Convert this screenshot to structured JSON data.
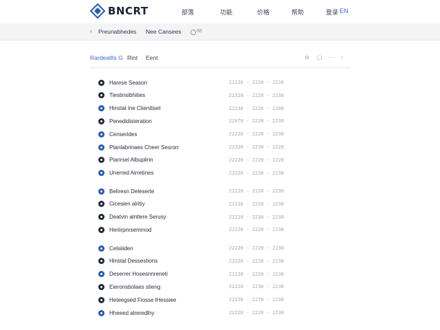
{
  "header": {
    "logo_text": "BNCRT",
    "nav": [
      "部落",
      "功能",
      "价格",
      "帮助",
      "登录",
      "EN"
    ]
  },
  "subbar": {
    "left_label": "Preunabhedes",
    "right_label": "Nee Cansees",
    "small_label": "88"
  },
  "toolbar": {
    "tabs": [
      "Rardeatlts G",
      "Rint",
      "Eent"
    ]
  },
  "groups": [
    {
      "rows": [
        {
          "label": "Harese Season",
          "date": "22228 - 2220 - 2228",
          "color": "#1f2937"
        },
        {
          "label": "Tiestinsibhities",
          "date": "22328 - 2228 - 2238",
          "color": "#1f2937"
        },
        {
          "label": "Hinstat lne Clienitiset",
          "date": "22238 - 2226 - 2288",
          "color": "#2a5aa6"
        },
        {
          "label": "Penedidisteration",
          "date": "22078 - 2228 - 2238",
          "color": "#1f2937"
        },
        {
          "label": "Censerides",
          "date": "22228 - 2228 - 2238",
          "color": "#2a5aa6"
        },
        {
          "label": "Ptanlabrinaes Cheer Sesrorr",
          "date": "22328 - 2230 - 2228",
          "color": "#2a5aa6"
        },
        {
          "label": "Pianrsel Albuplinn",
          "date": "22228 - 2220 - 2228",
          "color": "#1f2937"
        },
        {
          "label": "Unerred Airretines",
          "date": "22228 - 2230 - 2238",
          "color": "#2a5aa6"
        }
      ]
    },
    {
      "rows": [
        {
          "label": "Beliresn Deleserte",
          "date": "22228 - 2220 - 2238",
          "color": "#2a5aa6"
        },
        {
          "label": "Cicesien alritiy",
          "date": "22228 - 2258 - 2238",
          "color": "#1f2937"
        },
        {
          "label": "Deatvin alntlere Serusy",
          "date": "22228 - 2230 - 2238",
          "color": "#1f2937"
        },
        {
          "label": "Heriirpnrsemmod",
          "date": "22228 - 2220 - 2238",
          "color": "#1f2937"
        }
      ]
    },
    {
      "rows": [
        {
          "label": "Celsiiiden",
          "date": "22228 - 2220 - 2238",
          "color": "#2a5aa6"
        },
        {
          "label": "Hinstal Dessestions",
          "date": "22228 - 2228 - 2238",
          "color": "#1f2937"
        },
        {
          "label": "Deserrer Hosesnnreneti",
          "date": "22228 - 2228 - 2238",
          "color": "#2a5aa6"
        },
        {
          "label": "Eieronsbolaes stieng",
          "date": "22228 - 2230 - 2238",
          "color": "#1f2937"
        },
        {
          "label": "Heteegsed Fiosse lHessiee",
          "date": "22228 - 2278 - 2238",
          "color": "#1f2937"
        },
        {
          "label": "Hheeed alreredlhy",
          "date": "22228 - 2220 - 2238",
          "color": "#2a5aa6"
        }
      ]
    }
  ],
  "colors": {
    "accent": "#3d67c2",
    "subbar_bg": "#f3f4f6"
  }
}
